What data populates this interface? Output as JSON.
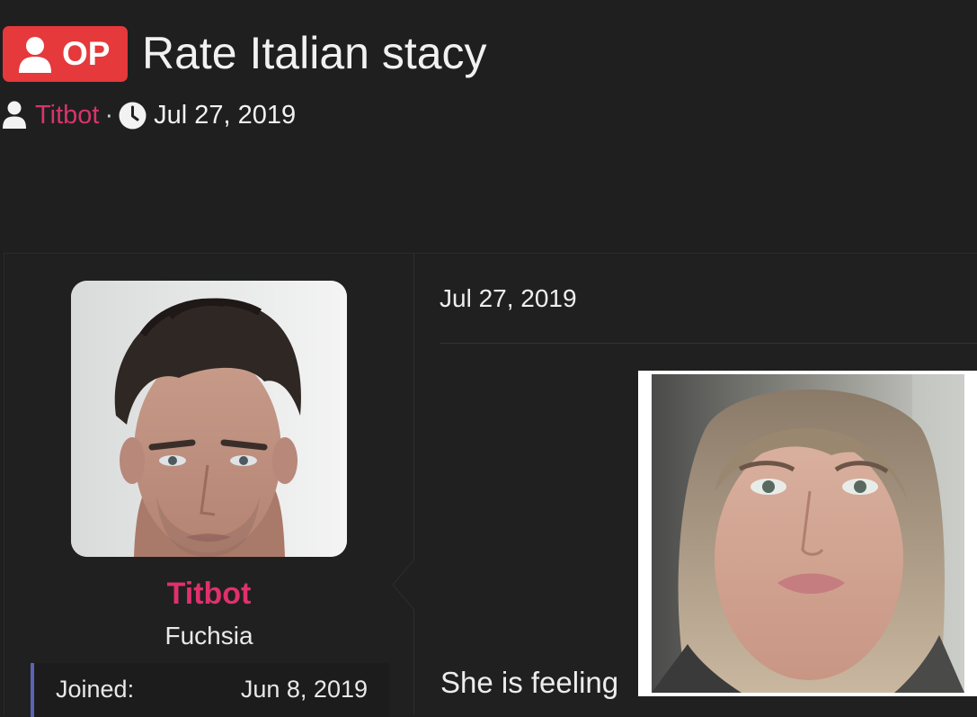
{
  "thread": {
    "badge_label": "OP",
    "title": "Rate Italian stacy",
    "author": "Titbot",
    "separator": "·",
    "date": "Jul 27, 2019"
  },
  "post": {
    "date": "Jul 27, 2019",
    "body_text": "She is feeling",
    "user": {
      "name": "Titbot",
      "title": "Fuchsia",
      "joined_label": "Joined:",
      "joined_value": "Jun 8, 2019"
    }
  },
  "colors": {
    "background": "#1f1f1f",
    "op_badge": "#e5393c",
    "username": "#e0306d",
    "accent_bar": "#5a63b5"
  },
  "icons": {
    "badge": "user-icon",
    "author": "user-icon",
    "date": "clock-icon"
  }
}
